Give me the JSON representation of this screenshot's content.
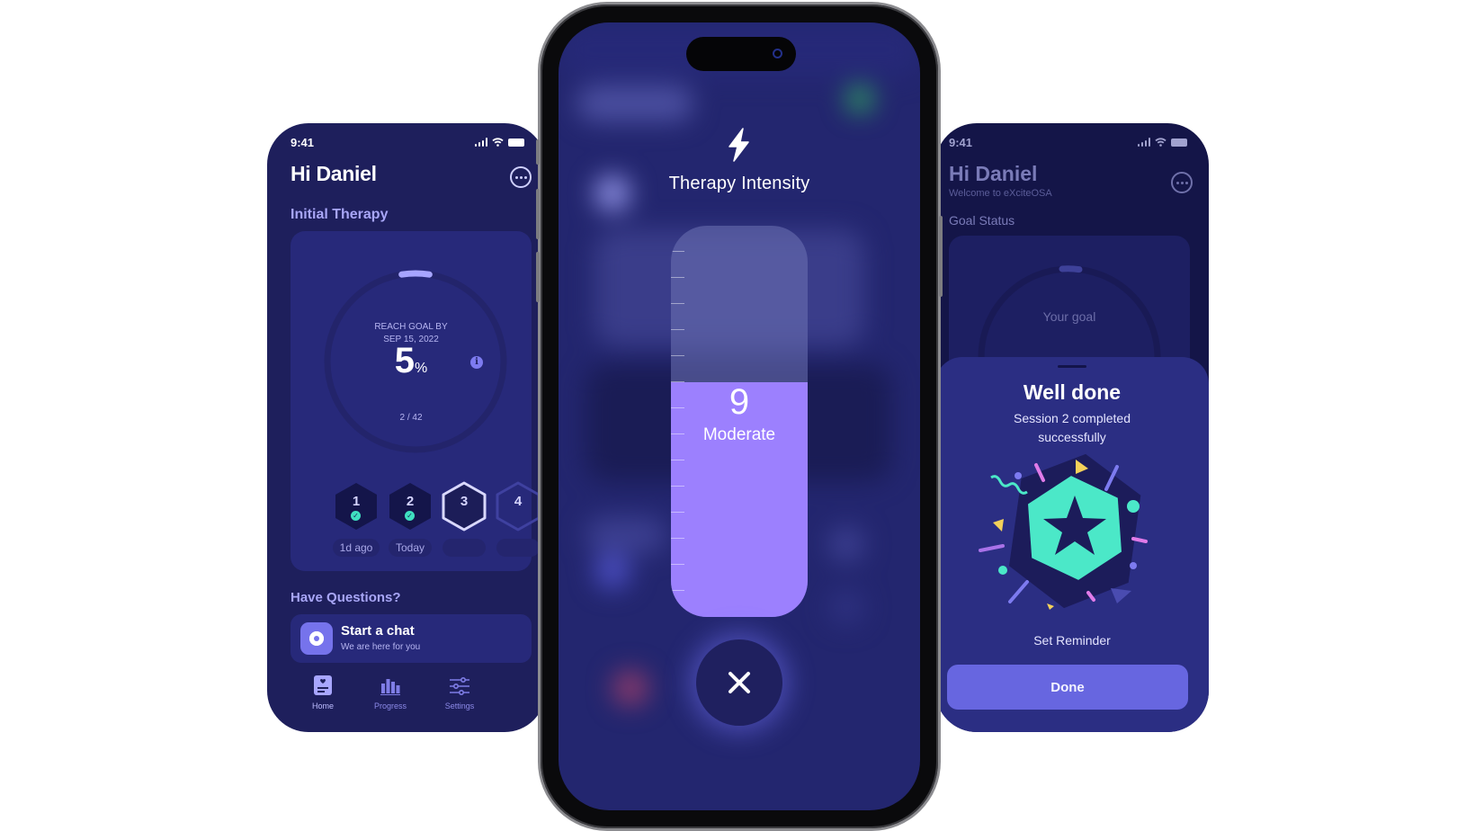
{
  "left_phone": {
    "status_time": "9:41",
    "greeting": "Hi Daniel",
    "section_title": "Initial Therapy",
    "goal": {
      "label_line1": "REACH GOAL BY",
      "label_line2": "SEP 15, 2022",
      "percent": "5",
      "percent_unit": "%",
      "progress_fraction": 0.05,
      "count": "2 / 42",
      "info_icon": "i"
    },
    "sessions": [
      {
        "number": "1",
        "completed": true,
        "label": "1d ago"
      },
      {
        "number": "2",
        "completed": true,
        "label": "Today"
      },
      {
        "number": "3",
        "completed": false,
        "label": ""
      },
      {
        "number": "4",
        "completed": false,
        "label": ""
      }
    ],
    "questions_title": "Have Questions?",
    "chat": {
      "title": "Start a chat",
      "subtitle": "We are here for you"
    },
    "tabs": [
      {
        "label": "Home",
        "icon": "home-card-icon",
        "active": true
      },
      {
        "label": "Progress",
        "icon": "bar-chart-icon",
        "active": false
      },
      {
        "label": "Settings",
        "icon": "sliders-icon",
        "active": false
      }
    ]
  },
  "center_phone": {
    "title": "Therapy Intensity",
    "icon": "lightning-bolt-icon",
    "intensity": {
      "value": "9",
      "label": "Moderate",
      "fill_fraction": 0.6
    },
    "close_icon": "close-x-icon"
  },
  "right_phone": {
    "status_time": "9:41",
    "greeting": "Hi Daniel",
    "subtitle": "Welcome to eXciteOSA",
    "section_title": "Goal Status",
    "goal_label": "Your goal",
    "sheet": {
      "title": "Well done",
      "message": "Session 2 completed successfully",
      "badge_icon": "star-hexagon-badge-icon",
      "link": "Set Reminder",
      "button": "Done"
    }
  },
  "colors": {
    "primary_bg": "#1e1f5c",
    "card_bg": "#27297a",
    "accent_purple": "#9c80fe",
    "button_purple": "#6766e0",
    "teal": "#3fe0c0",
    "section_text": "#a8a6f7"
  }
}
